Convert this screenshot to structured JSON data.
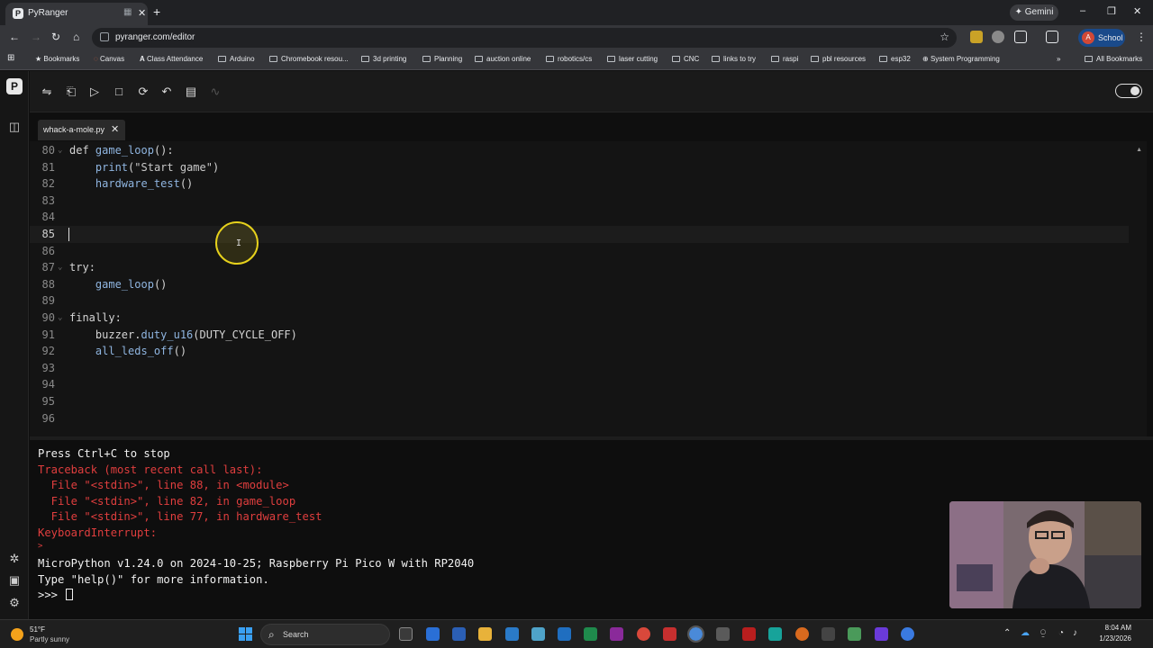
{
  "browser": {
    "tab_title": "PyRanger",
    "tab_favicon": "P",
    "new_tab": "+",
    "gemini_label": "✦ Gemini",
    "url": "pyranger.com/editor",
    "profile_initial": "A",
    "profile_label": "School",
    "window_controls": [
      "–",
      "❐",
      "✕"
    ],
    "bookmarks": [
      "Bookmarks",
      "Canvas",
      "Class Attendance",
      "Arduino",
      "Chromebook resou...",
      "3d printing",
      "Planning",
      "auction online",
      "robotics/cs",
      "laser cutting",
      "CNC",
      "links to try",
      "raspi",
      "pbl resources",
      "esp32",
      "System Programming",
      "All Bookmarks"
    ],
    "bookmarks_overflow": "»"
  },
  "app": {
    "logo": "P",
    "file_tab": {
      "name": "whack-a-mole.py",
      "close": "✕"
    }
  },
  "editor": {
    "lines": [
      {
        "n": "80",
        "fold": "⌄",
        "parts": [
          [
            "kw",
            "def "
          ],
          [
            "fn",
            "game_loop"
          ],
          [
            "p",
            "():"
          ]
        ]
      },
      {
        "n": "81",
        "parts": [
          [
            "p",
            "    "
          ],
          [
            "fn",
            "print"
          ],
          [
            "p",
            "("
          ],
          [
            "str",
            "\"Start game\""
          ],
          [
            "p",
            ")"
          ]
        ]
      },
      {
        "n": "82",
        "parts": [
          [
            "p",
            "    "
          ],
          [
            "fn",
            "hardware_test"
          ],
          [
            "p",
            "()"
          ]
        ]
      },
      {
        "n": "83",
        "parts": []
      },
      {
        "n": "84",
        "parts": []
      },
      {
        "n": "85",
        "parts": [],
        "current": true
      },
      {
        "n": "86",
        "parts": []
      },
      {
        "n": "87",
        "fold": "⌄",
        "parts": [
          [
            "kw",
            "try"
          ],
          [
            "p",
            ":"
          ]
        ]
      },
      {
        "n": "88",
        "parts": [
          [
            "p",
            "    "
          ],
          [
            "fn",
            "game_loop"
          ],
          [
            "p",
            "()"
          ]
        ]
      },
      {
        "n": "89",
        "parts": []
      },
      {
        "n": "90",
        "fold": "⌄",
        "parts": [
          [
            "kw",
            "finally"
          ],
          [
            "p",
            ":"
          ]
        ]
      },
      {
        "n": "91",
        "parts": [
          [
            "p",
            "    buzzer."
          ],
          [
            "fn",
            "duty_u16"
          ],
          [
            "p",
            "(DUTY_CYCLE_OFF)"
          ]
        ]
      },
      {
        "n": "92",
        "parts": [
          [
            "p",
            "    "
          ],
          [
            "fn",
            "all_leds_off"
          ],
          [
            "p",
            "()"
          ]
        ]
      },
      {
        "n": "93",
        "parts": []
      },
      {
        "n": "94",
        "parts": []
      },
      {
        "n": "95",
        "parts": []
      },
      {
        "n": "96",
        "parts": []
      }
    ]
  },
  "console": {
    "lines": [
      {
        "text": "Press Ctrl+C to stop",
        "color": "w"
      },
      {
        "text": "Traceback (most recent call last):",
        "color": "r"
      },
      {
        "text": "  File \"<stdin>\", line 88, in <module>",
        "color": "r"
      },
      {
        "text": "  File \"<stdin>\", line 82, in game_loop",
        "color": "r"
      },
      {
        "text": "  File \"<stdin>\", line 77, in hardware_test",
        "color": "r"
      },
      {
        "text": "KeyboardInterrupt:",
        "color": "r"
      },
      {
        "text": ">",
        "color": "r",
        "small": true
      },
      {
        "text": "MicroPython v1.24.0 on 2024-10-25; Raspberry Pi Pico W with RP2040",
        "color": "w"
      },
      {
        "text": "Type \"help()\" for more information.",
        "color": "w"
      },
      {
        "text": ">>> ",
        "color": "w",
        "prompt": true
      }
    ]
  },
  "taskbar": {
    "temp": "51°F",
    "weather": "Partly sunny",
    "search_label": "Search",
    "time": "8:04 AM",
    "date": "1/23/2026"
  },
  "colors": {
    "console_error": "#e03e3e",
    "cursor_highlight": "#e6d11c",
    "function_name": "#8fb5e0"
  }
}
